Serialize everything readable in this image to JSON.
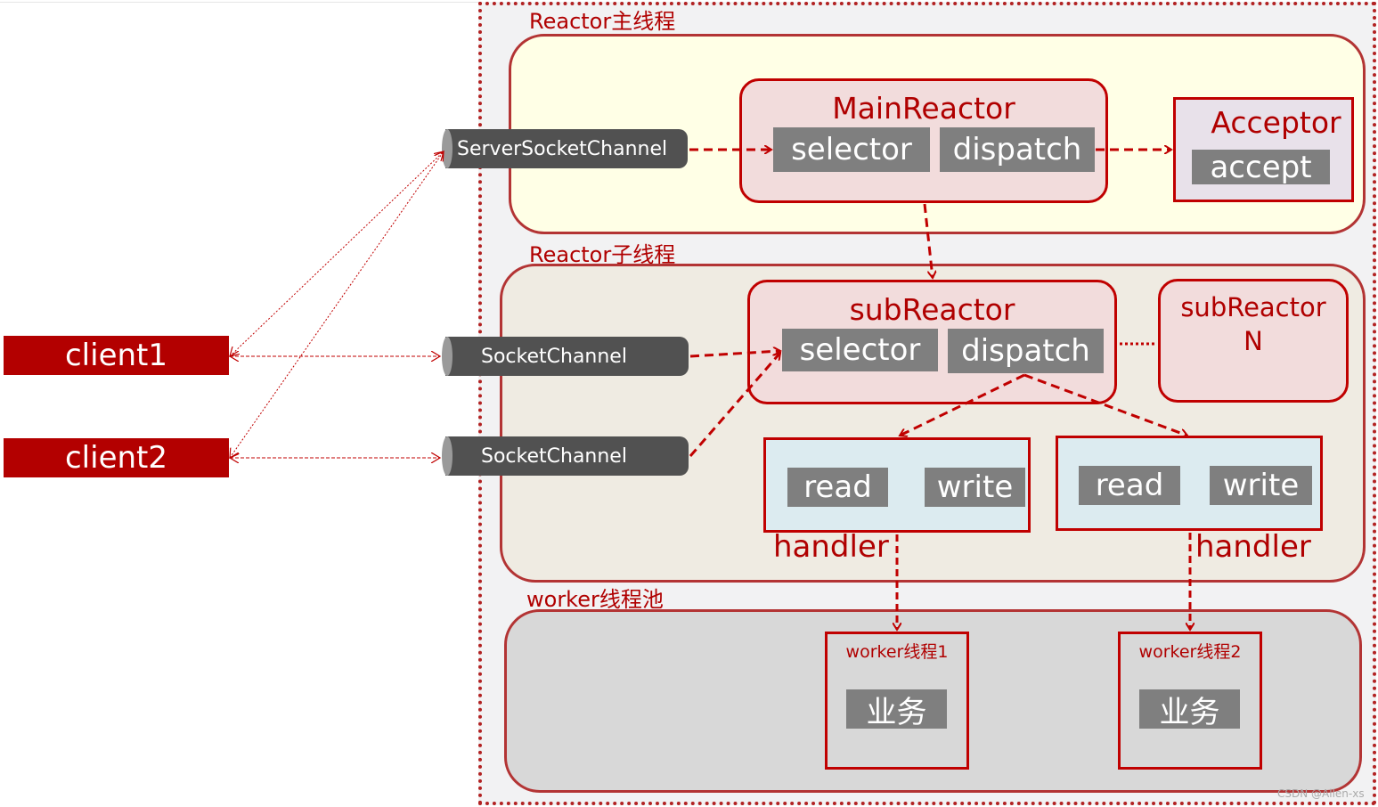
{
  "sections": {
    "main_thread": "Reactor主线程",
    "sub_thread": "Reactor子线程",
    "worker_pool": "worker线程池"
  },
  "clients": [
    "client1",
    "client2"
  ],
  "channels": {
    "server": "ServerSocketChannel",
    "socket1": "SocketChannel",
    "socket2": "SocketChannel"
  },
  "main_reactor": {
    "title": "MainReactor",
    "selector": "selector",
    "dispatch": "dispatch"
  },
  "acceptor": {
    "title": "Acceptor",
    "action": "accept"
  },
  "sub_reactor": {
    "title": "subReactor",
    "selector": "selector",
    "dispatch": "dispatch"
  },
  "sub_reactor_n": {
    "title_line1": "subReactor",
    "title_line2": "N"
  },
  "handlers": [
    {
      "read": "read",
      "write": "write",
      "label": "handler"
    },
    {
      "read": "read",
      "write": "write",
      "label": "handler"
    }
  ],
  "workers": [
    {
      "title": "worker线程1",
      "task": "业务"
    },
    {
      "title": "worker线程2",
      "task": "业务"
    }
  ],
  "watermark": "CSDN @Allen-xs",
  "colors": {
    "accent": "#c00000",
    "box_gray": "#7f7f7f",
    "channel": "#515151"
  }
}
